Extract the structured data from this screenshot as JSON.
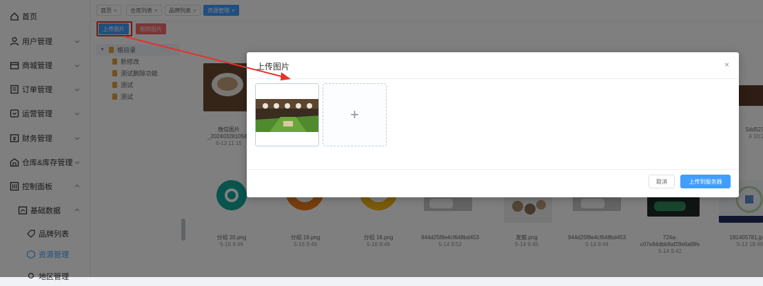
{
  "sidebar": {
    "items": [
      {
        "label": "首页",
        "icon": "home-icon"
      },
      {
        "label": "用户管理",
        "icon": "user-icon"
      },
      {
        "label": "商城管理",
        "icon": "shop-icon"
      },
      {
        "label": "订单管理",
        "icon": "order-icon"
      },
      {
        "label": "运营管理",
        "icon": "operation-icon"
      },
      {
        "label": "财务管理",
        "icon": "finance-icon"
      },
      {
        "label": "仓库&库存管理",
        "icon": "warehouse-icon"
      },
      {
        "label": "控制面板",
        "icon": "control-panel-icon"
      },
      {
        "label": "基础数据",
        "icon": "base-data-icon"
      },
      {
        "label": "品牌列表",
        "icon": "brand-icon"
      },
      {
        "label": "资源管理",
        "icon": "resource-icon"
      },
      {
        "label": "地区管理",
        "icon": "region-icon"
      }
    ]
  },
  "tabs": [
    {
      "label": "首页"
    },
    {
      "label": "仓库列表"
    },
    {
      "label": "品牌列表"
    },
    {
      "label": "资源管理"
    }
  ],
  "toolbar": {
    "upload_label": "上传图片",
    "delete_label": "删除图片"
  },
  "tree": {
    "root": "根目录",
    "children": [
      "新修改",
      "测试删除功能",
      "测试",
      "测试"
    ]
  },
  "gallery": {
    "top_captions": [
      {
        "name": "微信图片",
        "name2": "_2024032810565",
        "time": "6-13 11:15"
      },
      {
        "name": "5dd5276",
        "time": "4 10:22"
      }
    ],
    "items": [
      {
        "name": "分组 20.png",
        "time": "5-16 9:46"
      },
      {
        "name": "分组 19.png",
        "time": "5-16 9:46"
      },
      {
        "name": "分组 18.png",
        "time": "5-16 9:46"
      },
      {
        "name": "944d25f8e4cf648bd453",
        "time": "5-14 9:52"
      },
      {
        "name": "发箍.png",
        "time": "5-14 9:45"
      },
      {
        "name": "944d25f8e4cf648bd453",
        "time": "5-14 9:44"
      },
      {
        "name": "724a-",
        "name2": "c07e84dbb8af28e6af8fe",
        "time": "5-14 9:42"
      },
      {
        "name": "181405781.jp",
        "time": "5-13 18:49"
      }
    ]
  },
  "dialog": {
    "title": "上传图片",
    "close": "×",
    "add_symbol": "+",
    "cancel_label": "取消",
    "confirm_label": "上传到服务器"
  },
  "colors": {
    "primary": "#409eff",
    "danger": "#f56c6c",
    "annotation_red": "#e8302a"
  }
}
